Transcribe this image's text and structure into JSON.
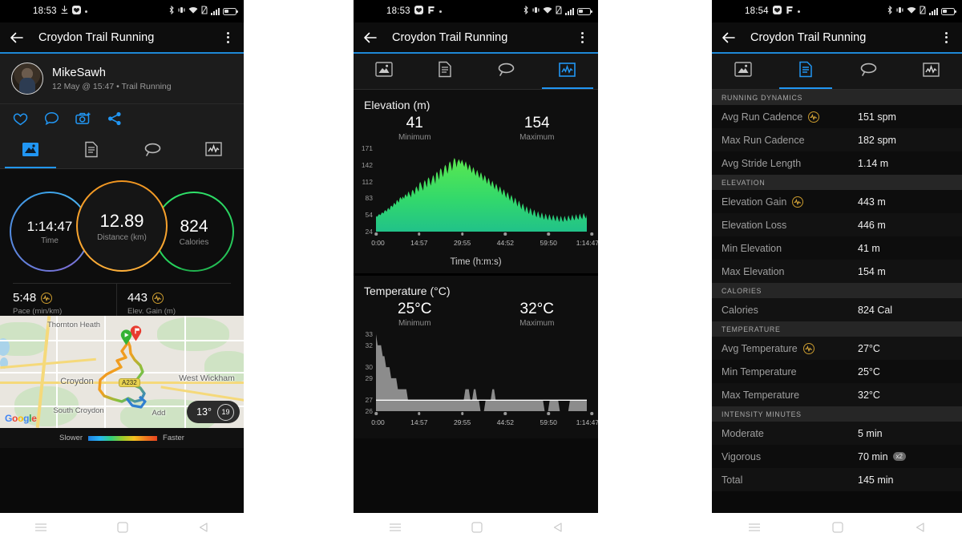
{
  "app": {
    "title": "Croydon Trail Running",
    "accent": "#1e88d6",
    "back_icon": "back-arrow-icon",
    "menu_icon": "kebab-menu-icon"
  },
  "status_bars": [
    {
      "time": "18:53",
      "icons": [
        "download-icon",
        "heart-shield-icon",
        "dot-icon"
      ]
    },
    {
      "time": "18:53",
      "icons": [
        "heart-shield-icon",
        "flag-icon",
        "dot-icon"
      ]
    },
    {
      "time": "18:54",
      "icons": [
        "heart-shield-icon",
        "flag-icon",
        "dot-icon"
      ]
    }
  ],
  "status_right_icons": [
    "bluetooth-icon",
    "vibrate-icon",
    "wifi-icon",
    "sim-icon",
    "signal-icon",
    "battery-icon"
  ],
  "tabs": [
    {
      "name": "map",
      "icon": "map-route-icon",
      "label": "Map"
    },
    {
      "name": "details",
      "icon": "document-list-icon",
      "label": "Details"
    },
    {
      "name": "laps",
      "icon": "laps-loop-icon",
      "label": "Laps"
    },
    {
      "name": "charts",
      "icon": "charts-graph-icon",
      "label": "Charts"
    }
  ],
  "panel1": {
    "profile": {
      "name": "MikeSawh",
      "meta": "12 May @ 15:47 • Trail Running",
      "avatar": "user-avatar"
    },
    "social": [
      {
        "name": "like-button",
        "icon": "heart-icon"
      },
      {
        "name": "comment-button",
        "icon": "speech-bubble-icon"
      },
      {
        "name": "photo-button",
        "icon": "camera-plus-icon"
      },
      {
        "name": "share-button",
        "icon": "share-icon"
      }
    ],
    "active_tab": "map",
    "rings": [
      {
        "name": "time",
        "value": "1:14:47",
        "label": "Time",
        "color": "#4fa8e8"
      },
      {
        "name": "distance",
        "value": "12.89",
        "label": "Distance (km)",
        "color": "#f0941f"
      },
      {
        "name": "calories",
        "value": "824",
        "label": "Calories",
        "color": "#24d05a"
      }
    ],
    "sub_stats": [
      {
        "name": "pace",
        "value": "5:48",
        "label": "Pace (min/km)",
        "badge": "hr-zone-icon"
      },
      {
        "name": "elevation-gain",
        "value": "443",
        "label": "Elev. Gain (m)",
        "badge": "hr-zone-icon"
      }
    ],
    "map": {
      "labels": [
        "Thornton Heath",
        "Croydon",
        "West Wickham",
        "South Croydon",
        "Add"
      ],
      "road_shield": "A232",
      "attribution": "Google",
      "start_pin": "start-pin-icon",
      "end_pin": "finish-pin-icon",
      "weather": {
        "temp": "13°",
        "wind": "19"
      },
      "legend": {
        "left": "Slower",
        "right": "Faster"
      }
    }
  },
  "panel2": {
    "active_tab": "charts",
    "charts": [
      {
        "title": "Elevation (m)",
        "summary": [
          {
            "value": "41",
            "label": "Minimum"
          },
          {
            "value": "154",
            "label": "Maximum"
          }
        ],
        "axis_label": "Time (h:m:s)"
      },
      {
        "title": "Temperature (°C)",
        "summary": [
          {
            "value": "25°C",
            "label": "Minimum"
          },
          {
            "value": "32°C",
            "label": "Maximum"
          }
        ],
        "axis_label": ""
      }
    ]
  },
  "panel3": {
    "active_tab": "details",
    "sections": [
      {
        "header": "RUNNING DYNAMICS",
        "rows": [
          {
            "key": "Avg Run Cadence",
            "value": "151 spm",
            "badge": "hr-zone-icon"
          },
          {
            "key": "Max Run Cadence",
            "value": "182 spm",
            "badge": ""
          },
          {
            "key": "Avg Stride Length",
            "value": "1.14 m",
            "badge": ""
          }
        ]
      },
      {
        "header": "ELEVATION",
        "rows": [
          {
            "key": "Elevation Gain",
            "value": "443 m",
            "badge": "hr-zone-icon"
          },
          {
            "key": "Elevation Loss",
            "value": "446 m",
            "badge": ""
          },
          {
            "key": "Min Elevation",
            "value": "41 m",
            "badge": ""
          },
          {
            "key": "Max Elevation",
            "value": "154 m",
            "badge": ""
          }
        ]
      },
      {
        "header": "CALORIES",
        "rows": [
          {
            "key": "Calories",
            "value": "824 Cal",
            "badge": ""
          }
        ]
      },
      {
        "header": "TEMPERATURE",
        "rows": [
          {
            "key": "Avg Temperature",
            "value": "27°C",
            "badge": "hr-zone-icon"
          },
          {
            "key": "Min Temperature",
            "value": "25°C",
            "badge": ""
          },
          {
            "key": "Max Temperature",
            "value": "32°C",
            "badge": ""
          }
        ]
      },
      {
        "header": "INTENSITY MINUTES",
        "rows": [
          {
            "key": "Moderate",
            "value": "5 min",
            "badge": ""
          },
          {
            "key": "Vigorous",
            "value": "70 min",
            "badge": "",
            "multiplier": "x2"
          },
          {
            "key": "Total",
            "value": "145 min",
            "badge": ""
          }
        ]
      }
    ]
  },
  "navbar": [
    {
      "name": "recents-button",
      "icon": "hamburger-icon"
    },
    {
      "name": "home-button",
      "icon": "square-icon"
    },
    {
      "name": "back-button",
      "icon": "triangle-left-icon"
    }
  ],
  "chart_data": [
    {
      "type": "area",
      "title": "Elevation (m)",
      "xlabel": "Time (h:m:s)",
      "ylabel": "Elevation (m)",
      "ylim": [
        24,
        171
      ],
      "yticks": [
        24,
        54,
        83,
        112,
        142,
        171
      ],
      "xticks": [
        "0:00",
        "14:57",
        "29:55",
        "44:52",
        "59:50",
        "1:14:47"
      ],
      "grid": false,
      "minimum": 41,
      "maximum": 154,
      "color": "#3ddc5a",
      "values": [
        52,
        50,
        51,
        53,
        55,
        54,
        53,
        56,
        58,
        57,
        56,
        60,
        62,
        61,
        59,
        63,
        66,
        64,
        62,
        68,
        70,
        69,
        67,
        72,
        75,
        73,
        71,
        78,
        80,
        77,
        75,
        82,
        85,
        83,
        80,
        86,
        84,
        82,
        88,
        90,
        87,
        85,
        92,
        95,
        90,
        88,
        84,
        94,
        98,
        96,
        92,
        89,
        100,
        104,
        101,
        97,
        94,
        108,
        112,
        109,
        104,
        100,
        96,
        110,
        115,
        112,
        106,
        102,
        116,
        120,
        117,
        110,
        105,
        112,
        118,
        124,
        121,
        114,
        108,
        126,
        130,
        127,
        120,
        115,
        132,
        136,
        133,
        126,
        120,
        128,
        138,
        142,
        139,
        132,
        126,
        134,
        144,
        148,
        145,
        138,
        131,
        140,
        150,
        154,
        151,
        144,
        137,
        146,
        149,
        152,
        148,
        143,
        147,
        151,
        147,
        142,
        138,
        144,
        148,
        143,
        137,
        132,
        139,
        143,
        138,
        132,
        127,
        134,
        138,
        133,
        127,
        122,
        129,
        133,
        128,
        122,
        118,
        125,
        129,
        124,
        118,
        113,
        120,
        124,
        119,
        113,
        108,
        115,
        119,
        114,
        108,
        103,
        110,
        114,
        109,
        103,
        98,
        105,
        109,
        104,
        98,
        93,
        100,
        104,
        99,
        93,
        88,
        95,
        99,
        94,
        88,
        83,
        90,
        94,
        89,
        83,
        78,
        85,
        89,
        84,
        78,
        73,
        80,
        84,
        79,
        73,
        68,
        75,
        79,
        74,
        68,
        63,
        70,
        74,
        69,
        63,
        58,
        65,
        69,
        64,
        58,
        55,
        62,
        66,
        61,
        55,
        52,
        59,
        63,
        58,
        52,
        49,
        56,
        60,
        55,
        50,
        47,
        54,
        58,
        53,
        48,
        45,
        52,
        56,
        51,
        47,
        44,
        51,
        55,
        50,
        46,
        43,
        50,
        54,
        49,
        45,
        42,
        49,
        53,
        48,
        44,
        41,
        48,
        52,
        47,
        43,
        41,
        48,
        52,
        47,
        44,
        42,
        49,
        53,
        48,
        45,
        43,
        50,
        54,
        49,
        46,
        44,
        51,
        55,
        50,
        47,
        45,
        52,
        56,
        51,
        48,
        46,
        53,
        57,
        52,
        49,
        47,
        54
      ]
    },
    {
      "type": "area",
      "title": "Temperature (°C)",
      "xlabel": "Time (h:m:s)",
      "ylabel": "Temperature (°C)",
      "ylim": [
        26,
        33
      ],
      "yticks": [
        26,
        27,
        29,
        30,
        32,
        33
      ],
      "xticks": [
        "0:00",
        "14:57",
        "29:55",
        "44:52",
        "59:50",
        "1:14:47"
      ],
      "grid": false,
      "minimum": 25,
      "maximum": 32,
      "reference_line": 27,
      "color": "#8c8c8c",
      "values": [
        33,
        32,
        32,
        32,
        31,
        31,
        30,
        30,
        30,
        29,
        29,
        29,
        29,
        28,
        28,
        28,
        28,
        28,
        28,
        27,
        27,
        27,
        27,
        27,
        27,
        27,
        27,
        27,
        27,
        27,
        27,
        27,
        27,
        27,
        27,
        27,
        27,
        27,
        27,
        27,
        27,
        27,
        27,
        27,
        27,
        27,
        27,
        27,
        27,
        27,
        27,
        27,
        27,
        28,
        28,
        28,
        27,
        27,
        28,
        28,
        27,
        27,
        26,
        26,
        26,
        27,
        27,
        27,
        27,
        28,
        28,
        27,
        27,
        27,
        27,
        27,
        27,
        27,
        27,
        27,
        27,
        27,
        27,
        27,
        27,
        27,
        27,
        27,
        27,
        27,
        27,
        27,
        27,
        27,
        27,
        27,
        27,
        27,
        27,
        27,
        26,
        26,
        26,
        27,
        27,
        27,
        27,
        27,
        27,
        26,
        26,
        26,
        26,
        26,
        26,
        27,
        27,
        27,
        27,
        27,
        27,
        27,
        27,
        27,
        27,
        27
      ]
    }
  ]
}
